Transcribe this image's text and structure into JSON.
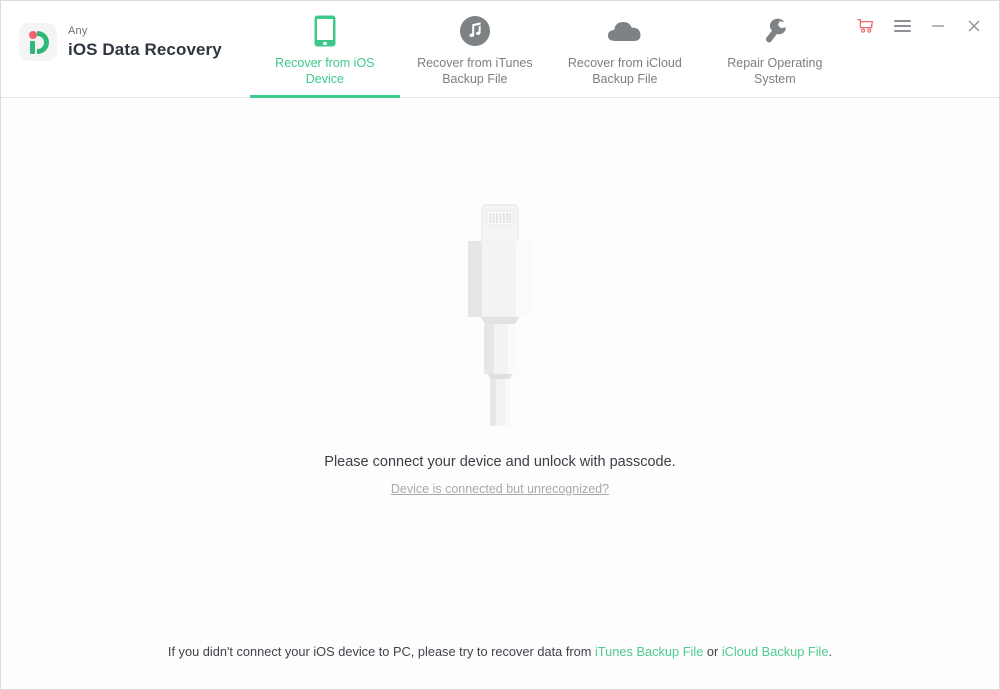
{
  "brand": {
    "sub": "Any",
    "title": "iOS Data Recovery",
    "logo_icon": "anydata-id-logo-icon",
    "accent_green": "#3ec98b",
    "accent_red": "#f4626d"
  },
  "tabs": [
    {
      "id": "recover-from-ios-device",
      "label": "Recover from iOS Device",
      "icon": "phone-icon",
      "active": true
    },
    {
      "id": "recover-from-itunes-backup",
      "label": "Recover from iTunes Backup File",
      "icon": "itunes-music-note-icon",
      "active": false
    },
    {
      "id": "recover-from-icloud-backup",
      "label": "Recover from iCloud Backup File",
      "icon": "cloud-icon",
      "active": false
    },
    {
      "id": "repair-operating-system",
      "label": "Repair Operating System",
      "icon": "wrench-icon",
      "active": false
    }
  ],
  "window_controls": {
    "cart": "shopping-cart-icon",
    "menu": "hamburger-menu-icon",
    "minimize": "minimize-icon",
    "close": "close-icon"
  },
  "main": {
    "illustration": "lightning-cable-illustration",
    "connect_message": "Please connect your device and unlock with passcode.",
    "unrecognized_link": "Device is connected but unrecognized?"
  },
  "footer": {
    "text_before": "If you didn't connect your iOS device to PC, please try to recover data from ",
    "itunes_link": "iTunes Backup File",
    "text_between": " or ",
    "icloud_link": "iCloud Backup File",
    "text_after": "."
  }
}
